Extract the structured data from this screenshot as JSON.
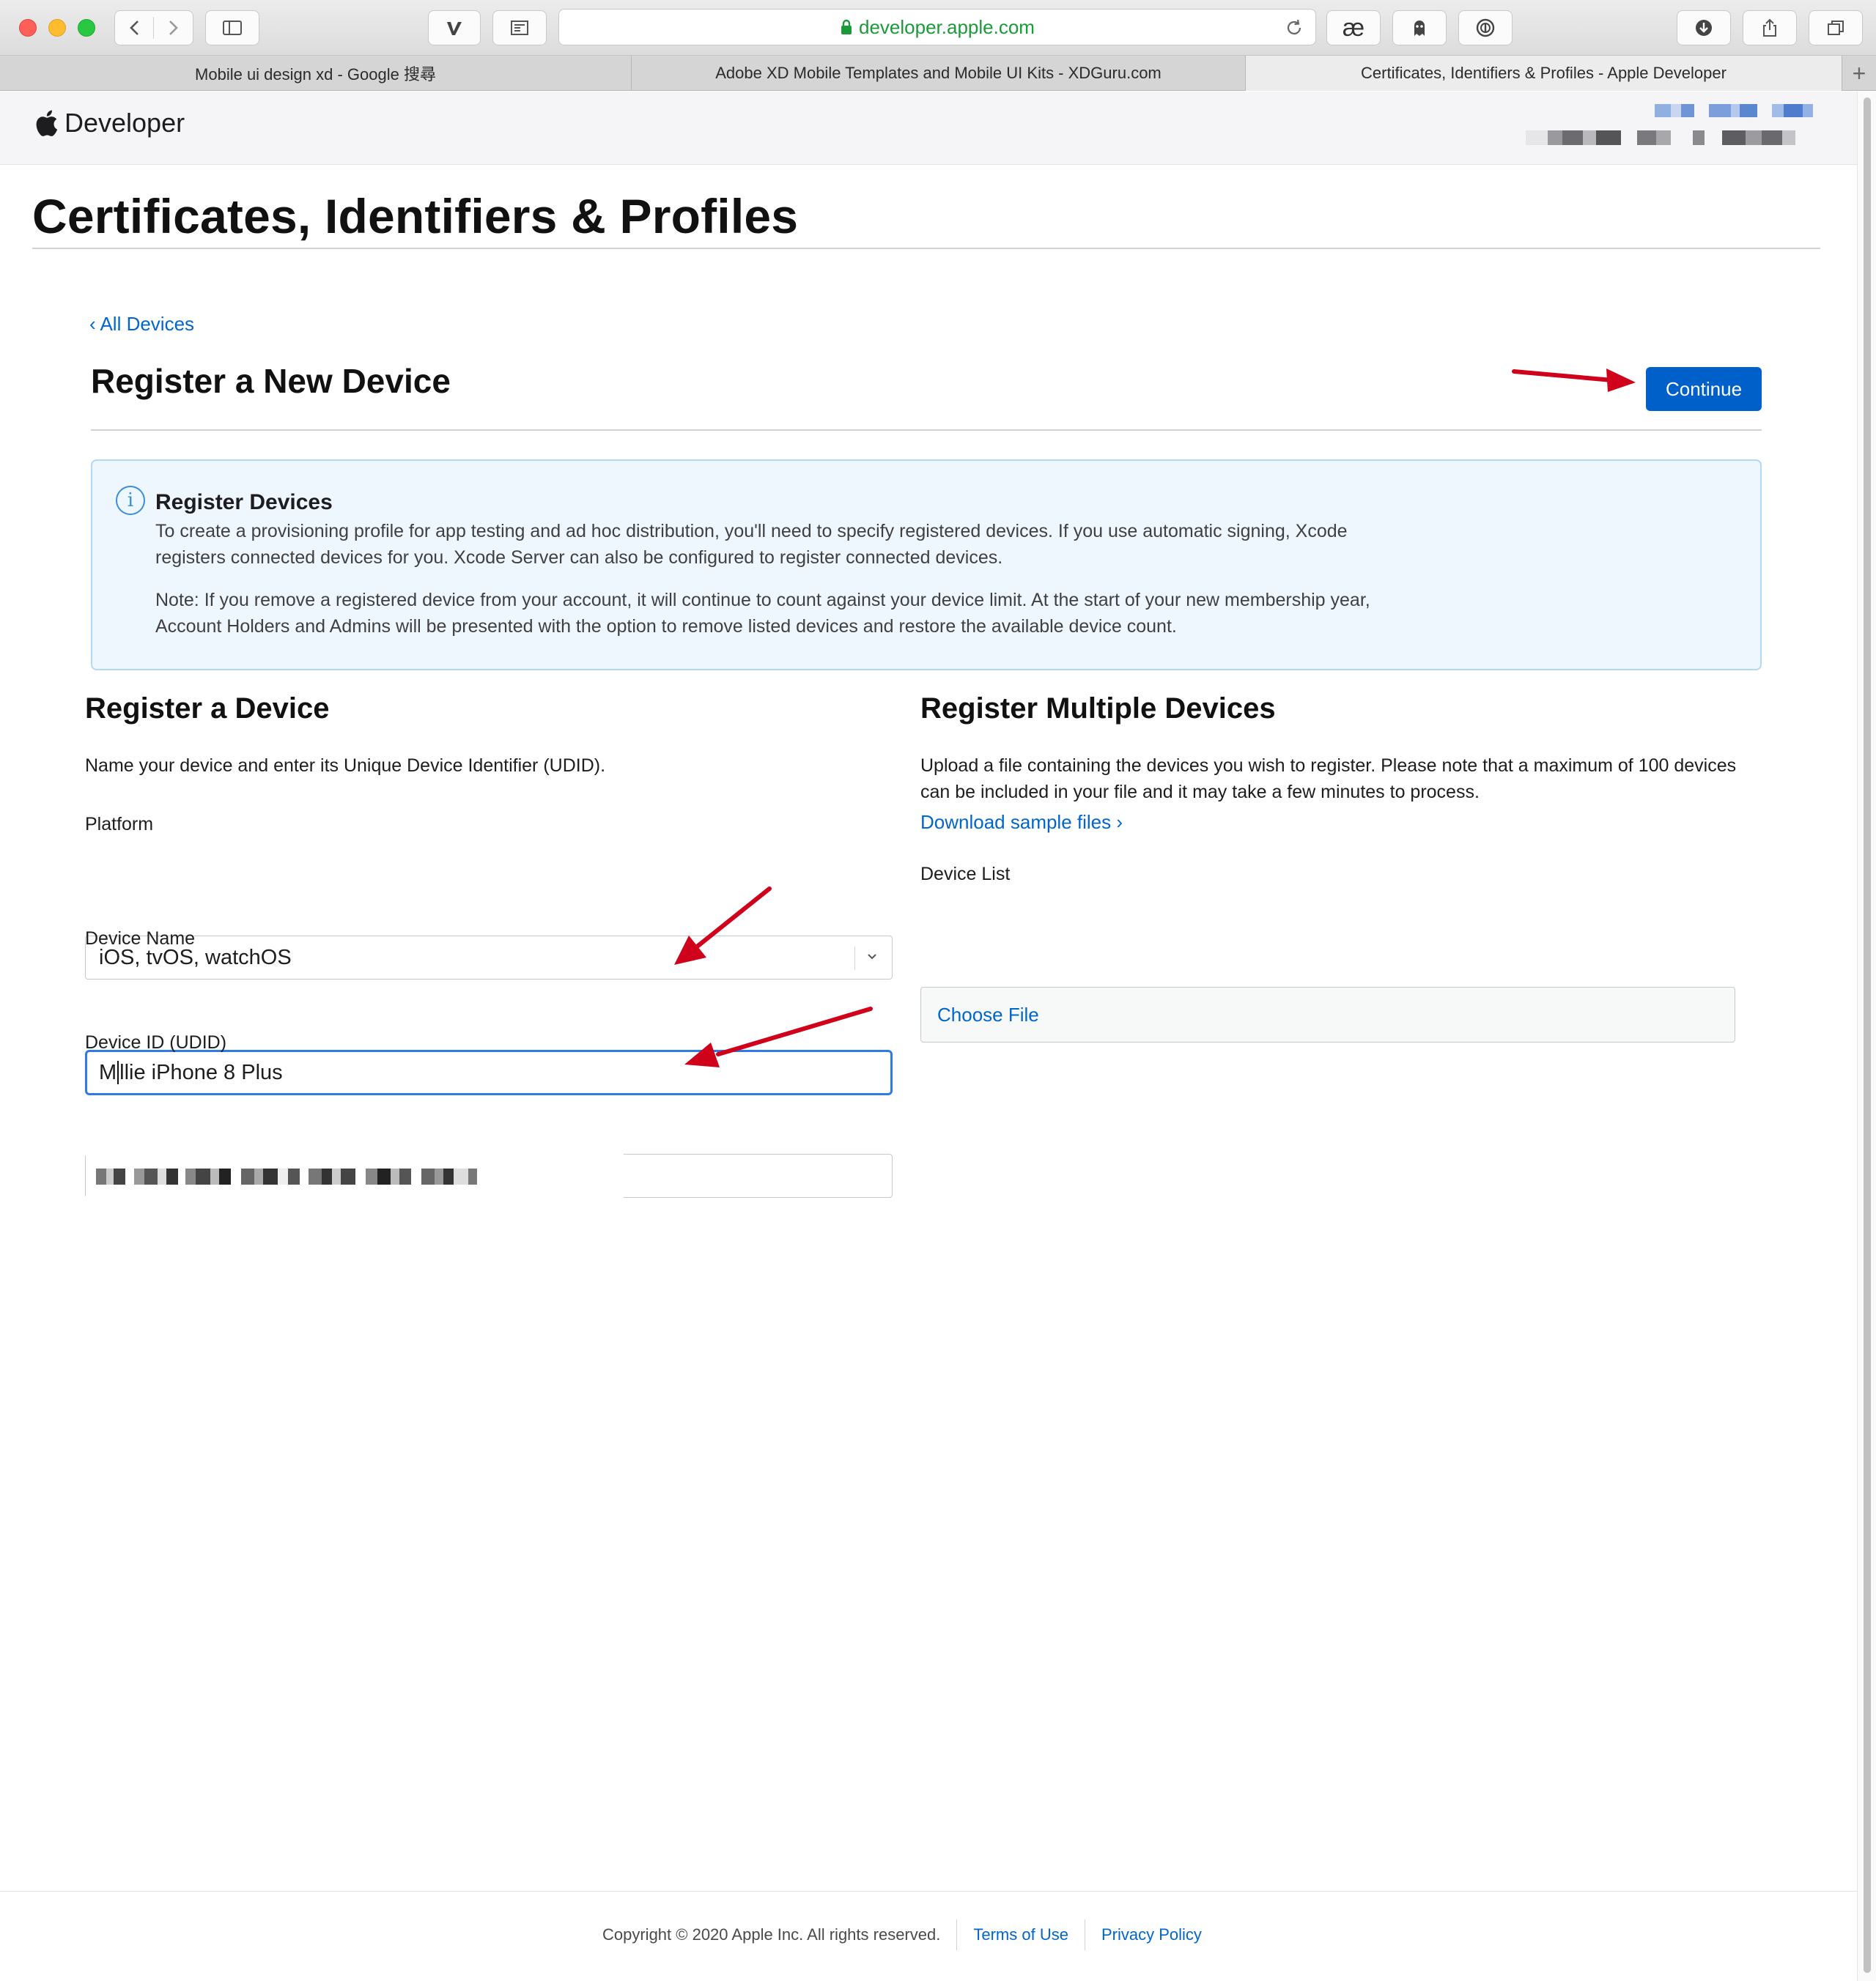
{
  "browser": {
    "url": "developer.apple.com",
    "tabs": [
      {
        "title": "Mobile ui design xd - Google 搜尋",
        "active": false
      },
      {
        "title": "Adobe XD Mobile Templates and Mobile UI Kits - XDGuru.com",
        "active": false
      },
      {
        "title": "Certificates, Identifiers & Profiles - Apple Developer",
        "active": true
      }
    ],
    "new_tab_label": "+"
  },
  "nav": {
    "brand": "Developer",
    "account_name": "[redacted]",
    "account_team": "[redacted]"
  },
  "page": {
    "title": "Certificates, Identifiers & Profiles",
    "back_link": "‹ All Devices",
    "section_title": "Register a New Device",
    "continue_label": "Continue"
  },
  "info": {
    "icon": "i",
    "title": "Register Devices",
    "paragraph1": "To create a provisioning profile for app testing and ad hoc distribution, you'll need to specify registered devices. If you use automatic signing, Xcode registers connected devices for you. Xcode Server can also be configured to register connected devices.",
    "paragraph2": "Note: If you remove a registered device from your account, it will continue to count against your device limit. At the start of your new membership year, Account Holders and Admins will be presented with the option to remove listed devices and restore the available device count."
  },
  "register_device": {
    "title": "Register a Device",
    "description": "Name your device and enter its Unique Device Identifier (UDID).",
    "platform_label": "Platform",
    "platform_value": "iOS, tvOS, watchOS",
    "device_name_label": "Device Name",
    "device_name_before_caret": "M",
    "device_name_after_caret": "llie iPhone 8 Plus",
    "device_id_label": "Device ID (UDID)",
    "device_id_value": "[redacted]"
  },
  "register_multiple": {
    "title": "Register Multiple Devices",
    "description": "Upload a file containing the devices you wish to register. Please note that a maximum of 100 devices can be included in your file and it may take a few minutes to process.",
    "download_link": "Download sample files ›",
    "device_list_label": "Device List",
    "choose_file_label": "Choose File"
  },
  "footer": {
    "copyright": "Copyright © 2020 Apple Inc. All rights reserved.",
    "terms": "Terms of Use",
    "privacy": "Privacy Policy"
  },
  "colors": {
    "accent": "#0060c9",
    "link": "#0066cc",
    "annotation_arrow": "#d0021b",
    "info_bg": "#eef6fe"
  }
}
